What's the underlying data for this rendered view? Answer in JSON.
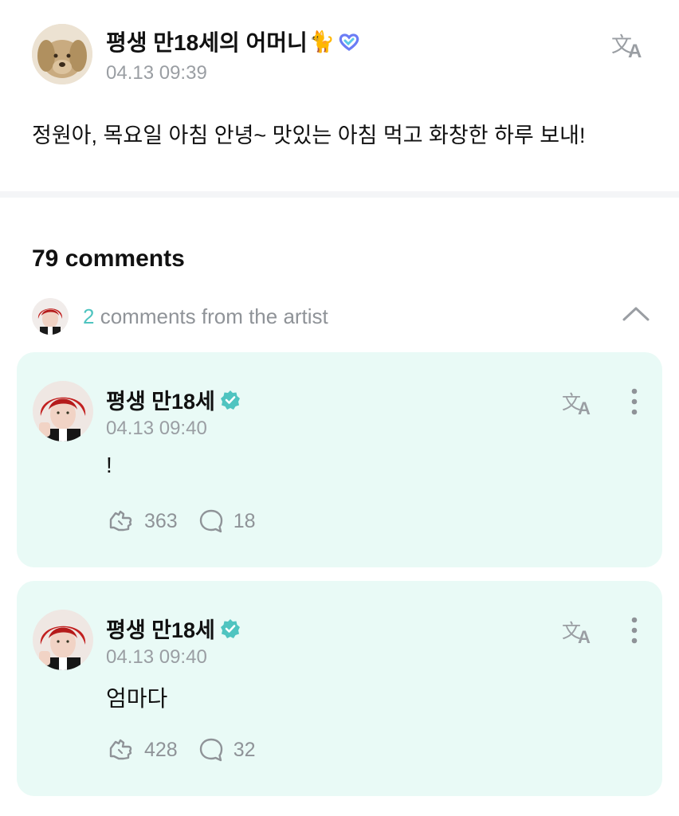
{
  "post": {
    "author": "평생 만18세의 어머니",
    "author_emoji": "🐈",
    "time": "04.13 09:39",
    "body": "정원아, 목요일 아침 안녕~ 맛있는 아침 먹고 화창한 하루 보내!",
    "icons": {
      "translate": "translate-icon",
      "badge": "heart-badge-icon"
    }
  },
  "comments_header": {
    "title": "79 comments",
    "artist_count": "2",
    "artist_label": "comments from the artist"
  },
  "comments": [
    {
      "author": "평생 만18세",
      "time": "04.13 09:40",
      "body": "!",
      "likes": "363",
      "replies": "18"
    },
    {
      "author": "평생 만18세",
      "time": "04.13 09:40",
      "body": "엄마다",
      "likes": "428",
      "replies": "32"
    }
  ],
  "colors": {
    "accent": "#4fc4c0",
    "card_bg": "#e9faf6",
    "muted_text": "#8f9398",
    "divider": "#f4f5f7"
  }
}
